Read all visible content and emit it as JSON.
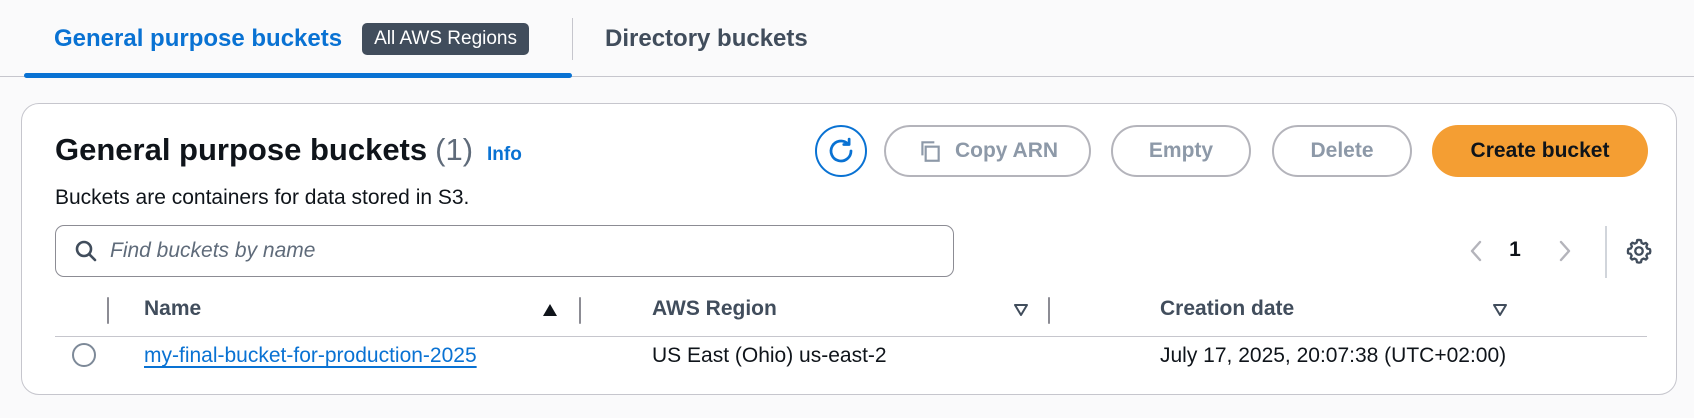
{
  "tabs": {
    "general_label": "General purpose buckets",
    "region_badge": "All AWS Regions",
    "directory_label": "Directory buckets"
  },
  "panel": {
    "title": "General purpose buckets",
    "count": "(1)",
    "info": "Info",
    "description": "Buckets are containers for data stored in S3."
  },
  "actions": {
    "refresh_icon": "refresh-icon",
    "copy_icon": "copy-icon",
    "copy_arn": "Copy ARN",
    "empty": "Empty",
    "delete": "Delete",
    "create": "Create bucket"
  },
  "search": {
    "placeholder": "Find buckets by name",
    "value": ""
  },
  "pagination": {
    "page": "1"
  },
  "table": {
    "columns": [
      {
        "label": "Name",
        "sort": "ascending"
      },
      {
        "label": "AWS Region",
        "sort": "none"
      },
      {
        "label": "Creation date",
        "sort": "none"
      }
    ],
    "rows": [
      {
        "name": "my-final-bucket-for-production-2025",
        "region": "US East (Ohio) us-east-2",
        "created": "July 17, 2025, 20:07:38 (UTC+02:00)",
        "selected": false
      }
    ]
  },
  "colors": {
    "link": "#0972d3",
    "primary_button": "#f49e33",
    "badge": "#414d5c",
    "disabled": "#8d99a8"
  }
}
